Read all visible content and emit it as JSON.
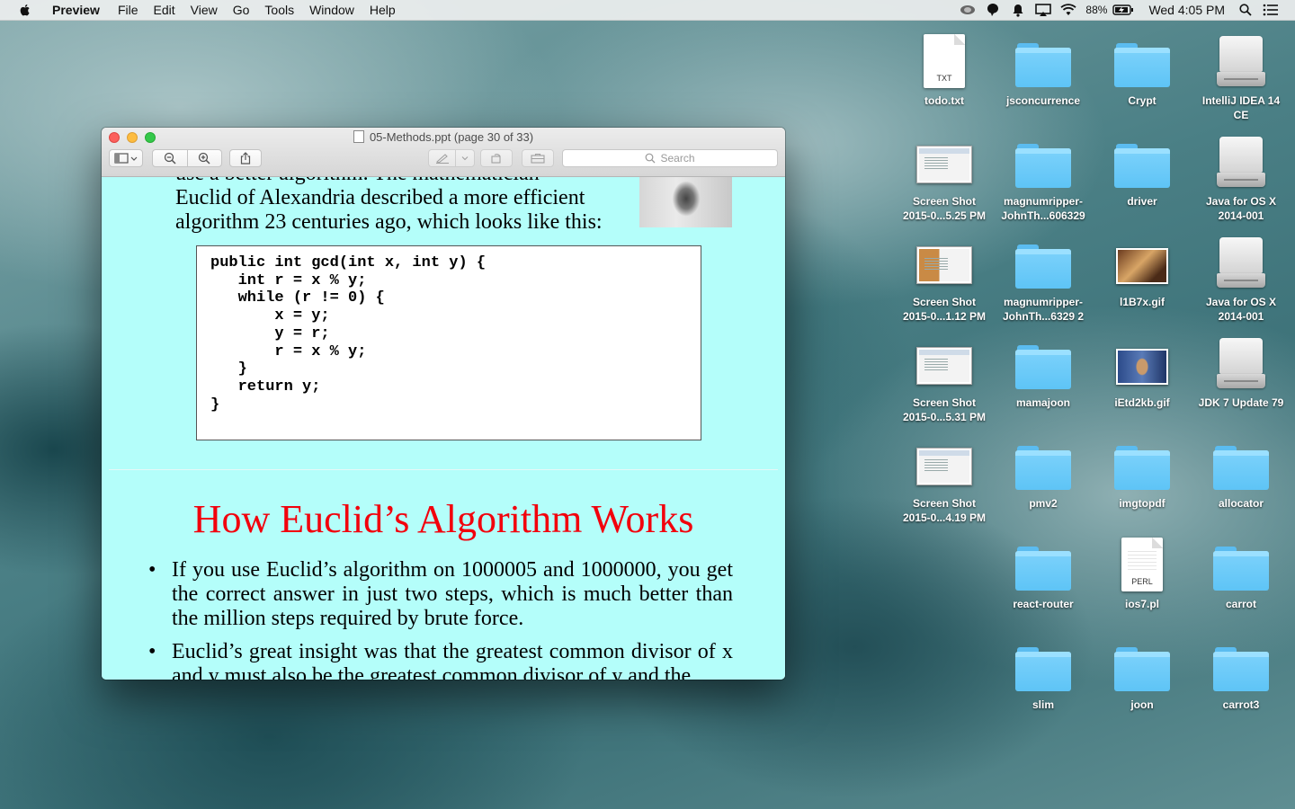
{
  "menubar": {
    "app_name": "Preview",
    "items": [
      "File",
      "Edit",
      "View",
      "Go",
      "Tools",
      "Window",
      "Help"
    ],
    "battery": "88%",
    "clock": "Wed 4:05 PM"
  },
  "window": {
    "title": "05-Methods.ppt (page 30 of 33)",
    "search_placeholder": "Search"
  },
  "slide_top": {
    "line_partial": "use a better algorithm. The mathematician",
    "line_1": "Euclid of Alexandria described a more efficient",
    "line_2": "algorithm 23 centuries ago, which looks like this:",
    "code": "public int gcd(int x, int y) {\n   int r = x % y;\n   while (r != 0) {\n       x = y;\n       y = r;\n       r = x % y;\n   }\n   return y;\n}"
  },
  "slide_next": {
    "title": "How Euclid’s Algorithm Works",
    "bullet_1": "If you use Euclid’s algorithm on 1000005 and 1000000, you get the correct answer in just two steps, which is much better than the million steps required by brute force.",
    "bullet_2": "Euclid’s great insight was that the greatest common divisor of x and y must also be the greatest common divisor of y and the"
  },
  "desktop": {
    "todo": {
      "line1": "todo.txt",
      "ext": "TXT"
    },
    "jsconcurrence": {
      "line1": "jsconcurrence"
    },
    "crypt": {
      "line1": "Crypt"
    },
    "intellij": {
      "line1": "IntelliJ IDEA 14",
      "line2": "CE"
    },
    "shot1": {
      "line1": "Screen Shot",
      "line2": "2015-0...5.25 PM"
    },
    "magnum1": {
      "line1": "magnumripper-",
      "line2": "JohnTh...606329"
    },
    "driver": {
      "line1": "driver"
    },
    "java1": {
      "line1": "Java for OS X",
      "line2": "2014-001"
    },
    "shot2": {
      "line1": "Screen Shot",
      "line2": "2015-0...1.12 PM"
    },
    "magnum2": {
      "line1": "magnumripper-",
      "line2": "JohnTh...6329 2"
    },
    "gif1": {
      "line1": "l1B7x.gif"
    },
    "java2": {
      "line1": "Java for OS X",
      "line2": "2014-001"
    },
    "shot3": {
      "line1": "Screen Shot",
      "line2": "2015-0...5.31 PM"
    },
    "mamajoon": {
      "line1": "mamajoon"
    },
    "gif2": {
      "line1": "iEtd2kb.gif"
    },
    "jdk": {
      "line1": "JDK 7 Update 79"
    },
    "shot4": {
      "line1": "Screen Shot",
      "line2": "2015-0...4.19 PM"
    },
    "pmv2": {
      "line1": "pmv2"
    },
    "imgtopdf": {
      "line1": "imgtopdf"
    },
    "allocator": {
      "line1": "allocator"
    },
    "reactrouter": {
      "line1": "react-router"
    },
    "ios7": {
      "line1": "ios7.pl",
      "ext": "PERL"
    },
    "carrot": {
      "line1": "carrot"
    },
    "slim": {
      "line1": "slim"
    },
    "joon": {
      "line1": "joon"
    },
    "carrot3": {
      "line1": "carrot3"
    }
  }
}
